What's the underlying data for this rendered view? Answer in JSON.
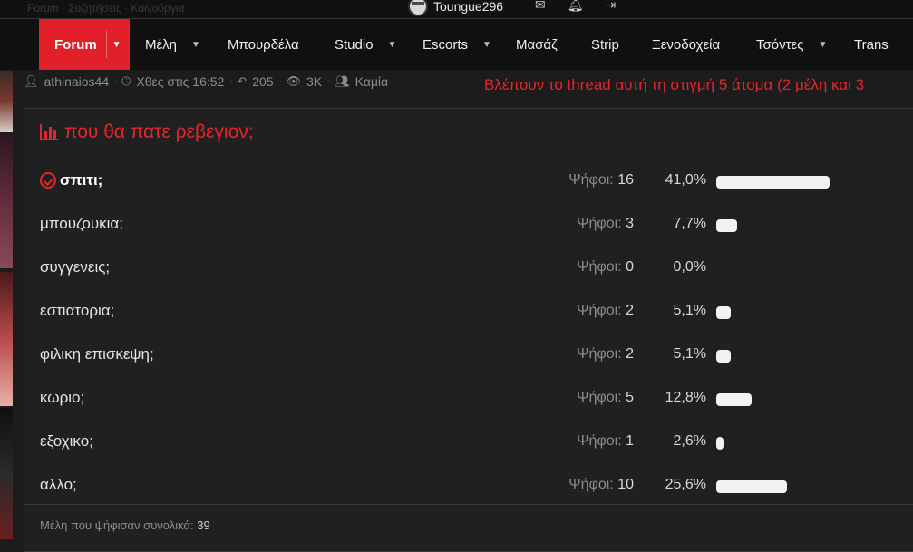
{
  "topbar": {
    "username": "Toungue296",
    "crumbs_text": "Forum  ·  Συζητήσεις  ·  Καινούργια"
  },
  "nav": {
    "items": [
      {
        "label": "Forum",
        "active": true,
        "caret": true
      },
      {
        "label": "Μέλη",
        "caret": true
      },
      {
        "label": "Μπουρδέλα",
        "caret": false
      },
      {
        "label": "Studio",
        "caret": true
      },
      {
        "label": "Escorts",
        "caret": true
      },
      {
        "label": "Μασάζ",
        "caret": false
      },
      {
        "label": "Strip",
        "caret": false
      },
      {
        "label": "Ξενοδοχεία",
        "caret": false
      },
      {
        "label": "Τσόντες",
        "caret": true
      },
      {
        "label": "Trans",
        "caret": false
      }
    ]
  },
  "thread_meta": {
    "author": "athinaios44",
    "date": "Χθες στις 16:52",
    "replies": "205",
    "views": "3K",
    "participants": "Καμία"
  },
  "viewing_text": "Βλέπουν το thread αυτή τη στιγμή 5 άτομα (2 μέλη και 3",
  "poll": {
    "title": "που θα πατε ρεβεγιον;",
    "votes_label": "Ψήφοι:",
    "options": [
      {
        "label": "σπιτι;",
        "votes": "16",
        "percent": "41,0%",
        "voted": true
      },
      {
        "label": "μπουζουκια;",
        "votes": "3",
        "percent": "7,7%"
      },
      {
        "label": "συγγενεις;",
        "votes": "0",
        "percent": "0,0%"
      },
      {
        "label": "εστιατορια;",
        "votes": "2",
        "percent": "5,1%"
      },
      {
        "label": "φιλικη επισκεψη;",
        "votes": "2",
        "percent": "5,1%"
      },
      {
        "label": "κωριο;",
        "votes": "5",
        "percent": "12,8%"
      },
      {
        "label": "εξοχικο;",
        "votes": "1",
        "percent": "2,6%"
      },
      {
        "label": "αλλο;",
        "votes": "10",
        "percent": "25,6%"
      }
    ],
    "total_label": "Μέλη που ψήφισαν συνολικά:",
    "total": "39"
  },
  "colors": {
    "accent": "#e3262e",
    "background": "#1c1c1c",
    "bar": "#f2f2f2"
  }
}
